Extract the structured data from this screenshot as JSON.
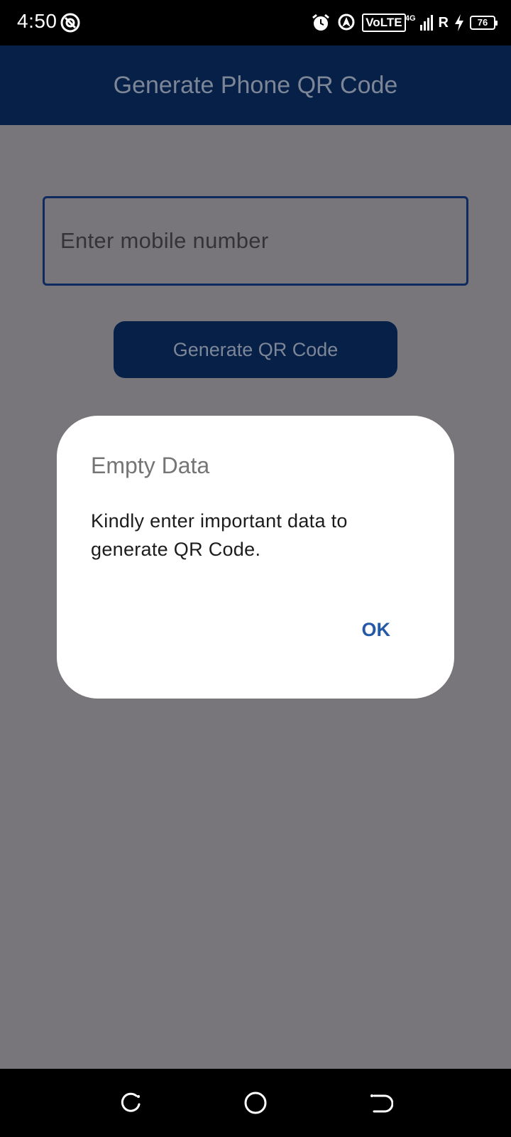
{
  "status_bar": {
    "time": "4:50",
    "volte": "VoLTE",
    "network": "4G",
    "roaming": "R",
    "battery": "76"
  },
  "app_bar": {
    "title": "Generate Phone QR Code"
  },
  "form": {
    "phone_placeholder": "Enter mobile number",
    "generate_label": "Generate QR Code"
  },
  "dialog": {
    "title": "Empty Data",
    "message": "Kindly enter important data to generate QR Code.",
    "ok_label": "OK"
  },
  "colors": {
    "app_bar": "#062048",
    "scrim_background": "#78767a",
    "dialog_action": "#2559a8"
  },
  "icons": {
    "status": [
      "hotspot-icon",
      "alarm-icon",
      "location-icon",
      "signal-icon",
      "charging-icon",
      "battery-icon"
    ],
    "nav": [
      "recents-icon",
      "home-icon",
      "back-icon"
    ]
  }
}
